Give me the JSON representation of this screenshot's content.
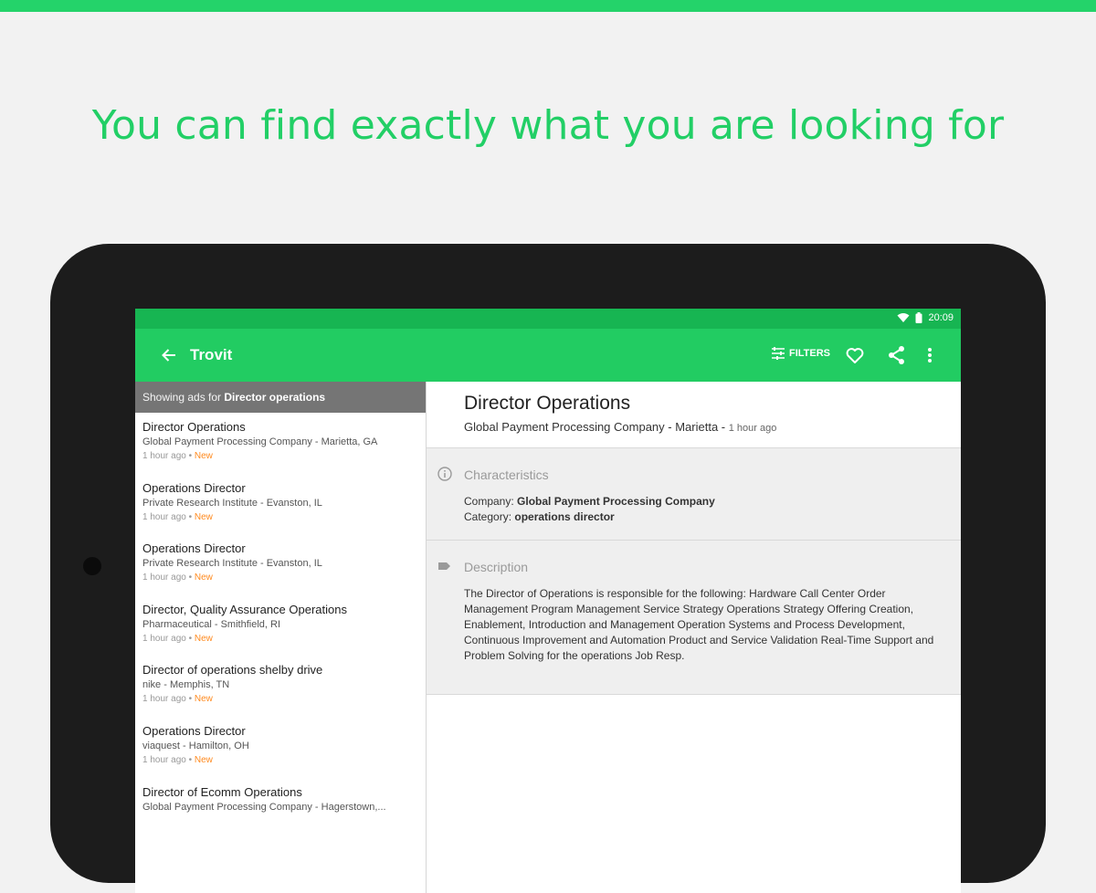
{
  "headline": "You can find exactly what you are looking for",
  "colors": {
    "brand_green": "#22cc62",
    "status_green": "#17b552",
    "new_badge": "#ff8a1f",
    "headline_green": "#22cf66"
  },
  "statusbar": {
    "time": "20:09",
    "icons": [
      "wifi-icon",
      "battery-icon"
    ]
  },
  "appbar": {
    "title": "Trovit",
    "filters_label": "FILTERS",
    "icons": [
      "back-arrow-icon",
      "filters-icon",
      "heart-icon",
      "share-icon",
      "more-vert-icon"
    ]
  },
  "results": {
    "banner_prefix": "Showing ads for ",
    "banner_query": "Director operations",
    "items": [
      {
        "title": "Director Operations",
        "subtitle": "Global Payment Processing Company - Marietta, GA",
        "time": "1 hour ago",
        "badge": "New"
      },
      {
        "title": "Operations Director",
        "subtitle": "Private Research Institute - Evanston, IL",
        "time": "1 hour ago",
        "badge": "New"
      },
      {
        "title": "Operations Director",
        "subtitle": "Private Research Institute - Evanston, IL",
        "time": "1 hour ago",
        "badge": "New"
      },
      {
        "title": "Director, Quality Assurance Operations",
        "subtitle": "Pharmaceutical - Smithfield, RI",
        "time": "1 hour ago",
        "badge": "New"
      },
      {
        "title": "Director of operations shelby drive",
        "subtitle": "nike - Memphis, TN",
        "time": "1 hour ago",
        "badge": "New"
      },
      {
        "title": "Operations Director",
        "subtitle": "viaquest - Hamilton, OH",
        "time": "1 hour ago",
        "badge": "New"
      },
      {
        "title": "Director of Ecomm Operations",
        "subtitle": "Global Payment Processing Company - Hagerstown,...",
        "time": "",
        "badge": ""
      }
    ]
  },
  "detail": {
    "title": "Director Operations",
    "company_location": "Global Payment Processing Company - Marietta",
    "time": "1 hour ago",
    "characteristics": {
      "label": "Characteristics",
      "company_label": "Company: ",
      "company_value": "Global Payment Processing Company",
      "category_label": "Category: ",
      "category_value": "operations director"
    },
    "description": {
      "label": "Description",
      "text": "The Director of Operations is responsible for the following: Hardware Call Center Order Management Program Management Service Strategy Operations Strategy Offering Creation, Enablement, Introduction and Management Operation Systems and Process Development, Continuous Improvement and Automation Product and Service Validation Real-Time Support and Problem Solving for the operations Job Resp."
    }
  }
}
